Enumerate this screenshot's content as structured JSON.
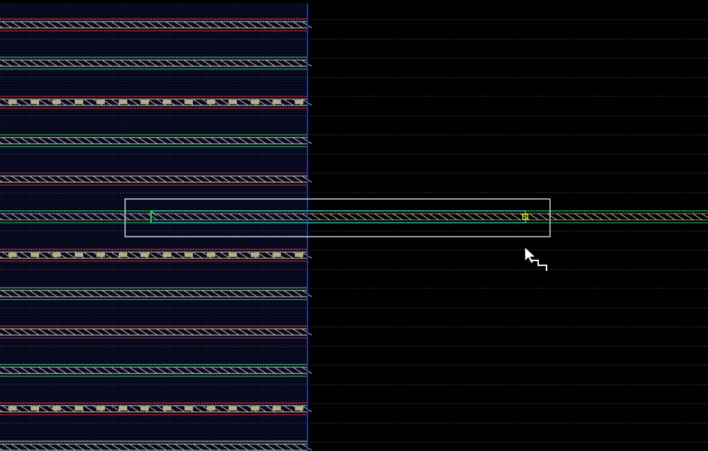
{
  "app": {
    "view": "layout-editor-canvas"
  },
  "colors": {
    "canvas_background": "#000000",
    "dotted_region_background": "#06081a",
    "dot_grid": "#1d2a66",
    "grid_lines": "#8a8a8a",
    "boundary_line": "#1a2fd8",
    "metal_red": "#e02a2a",
    "metal_green": "#2ad46a",
    "hatch": "#d8d2b8",
    "via_fill": "#b6ad86",
    "selection_box": "#d8d8f0",
    "selected_wire": "#2cc9b0",
    "endpoint_marker": "#e8e000",
    "cursor": "#ffffff"
  },
  "canvas": {
    "rows": [
      {
        "kind": "red-hatched"
      },
      {
        "kind": "green-hatched"
      },
      {
        "kind": "red-via"
      },
      {
        "kind": "green-hatched"
      },
      {
        "kind": "red-hatched"
      },
      {
        "kind": "selected-wire"
      },
      {
        "kind": "red-via"
      },
      {
        "kind": "green-hatched"
      },
      {
        "kind": "red-hatched"
      },
      {
        "kind": "green-hatched"
      },
      {
        "kind": "red-via"
      },
      {
        "kind": "hatched-only"
      }
    ],
    "selection": {
      "label": "",
      "has_endpoint_marker": true
    },
    "cursor": {
      "type": "arrow-with-snap-icon"
    }
  }
}
